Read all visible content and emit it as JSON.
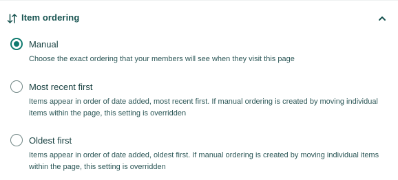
{
  "section": {
    "title": "Item ordering",
    "header_icon": "sort-arrows-icon",
    "toggle_icon": "chevron-up-icon"
  },
  "options": [
    {
      "label": "Manual",
      "description": "Choose the exact ordering that your members will see when they visit this page",
      "selected": true
    },
    {
      "label": "Most recent first",
      "description": "Items appear in order of date added, most recent first. If manual ordering is created by moving individual items within the page, this setting is overridden",
      "selected": false
    },
    {
      "label": "Oldest first",
      "description": "Items appear in order of date added, oldest first. If manual ordering is created by moving individual items within the page, this setting is overridden",
      "selected": false
    }
  ],
  "colors": {
    "accent": "#0f7a6e",
    "heading": "#16524f",
    "text": "#2c5757"
  }
}
